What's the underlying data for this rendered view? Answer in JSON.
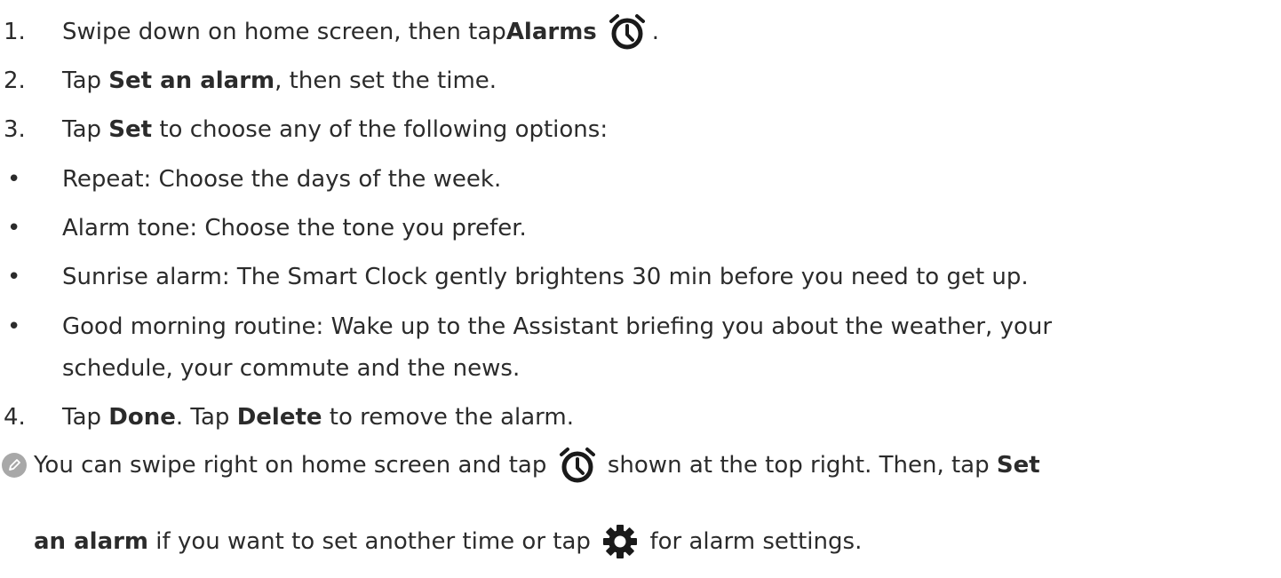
{
  "steps": [
    {
      "marker": "1.",
      "parts": [
        {
          "t": "Swipe down on home screen, then tap ",
          "b": false
        },
        {
          "t": "Alarms",
          "b": true
        },
        {
          "t": ".",
          "b": false
        }
      ],
      "icon": "alarm-clock-icon"
    },
    {
      "marker": "2.",
      "parts": [
        {
          "t": "Tap ",
          "b": false
        },
        {
          "t": "Set an alarm",
          "b": true
        },
        {
          "t": ", then set the time.",
          "b": false
        }
      ]
    },
    {
      "marker": "3.",
      "parts": [
        {
          "t": "Tap ",
          "b": false
        },
        {
          "t": "Set",
          "b": true
        },
        {
          "t": " to choose any of the following options:",
          "b": false
        }
      ]
    }
  ],
  "bullets": [
    "Repeat: Choose the days of the week.",
    "Alarm tone: Choose the tone you prefer.",
    "Sunrise alarm: The Smart Clock gently brightens 30 min before you need to get up.",
    "Good morning routine: Wake up to the Assistant briefing you about the weather, your",
    "schedule, your commute and the news."
  ],
  "step4": {
    "marker": "4.",
    "parts": [
      {
        "t": "Tap ",
        "b": false
      },
      {
        "t": "Done",
        "b": true
      },
      {
        "t": ". Tap ",
        "b": false
      },
      {
        "t": "Delete",
        "b": true
      },
      {
        "t": " to remove the alarm.",
        "b": false
      }
    ]
  },
  "note": {
    "icon": "pencil-note-icon",
    "line1": [
      {
        "t": "You can swipe right on home screen and tap ",
        "b": false
      },
      {
        "t": "alarm-clock-icon",
        "icon": true
      },
      {
        "t": " shown at the top right. Then, tap ",
        "b": false
      },
      {
        "t": "Set",
        "b": true
      }
    ],
    "line2": [
      {
        "t": "an alarm",
        "b": true
      },
      {
        "t": " if you want to set another time or tap ",
        "b": false
      },
      {
        "t": "gear-icon",
        "icon": true
      },
      {
        "t": " for alarm settings.",
        "b": false
      }
    ]
  },
  "bullet_char": "•",
  "colors": {
    "text": "#2b2b2b",
    "icon": "#1a1a1a",
    "note_icon_bg": "#a8a8a8"
  }
}
